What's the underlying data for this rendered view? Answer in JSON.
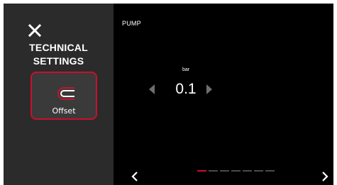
{
  "sidebar": {
    "close_icon": "close-icon",
    "title_line1": "TECHNICAL",
    "title_line2": "SETTINGS",
    "offset_button": {
      "icon": "offset-icon",
      "label": "Offset",
      "accent": "#c8102e"
    }
  },
  "main": {
    "title": "PUMP",
    "value_unit": "bar",
    "value": "0.1",
    "decrease_icon": "triangle-left-icon",
    "increase_icon": "triangle-right-icon",
    "prev_icon": "chevron-left-icon",
    "next_icon": "chevron-right-icon",
    "pager": {
      "total": 7,
      "active_index": 0
    }
  },
  "colors": {
    "background": "#000000",
    "sidebar": "#2b2b2b",
    "accent": "#c8102e",
    "text": "#ffffff"
  }
}
